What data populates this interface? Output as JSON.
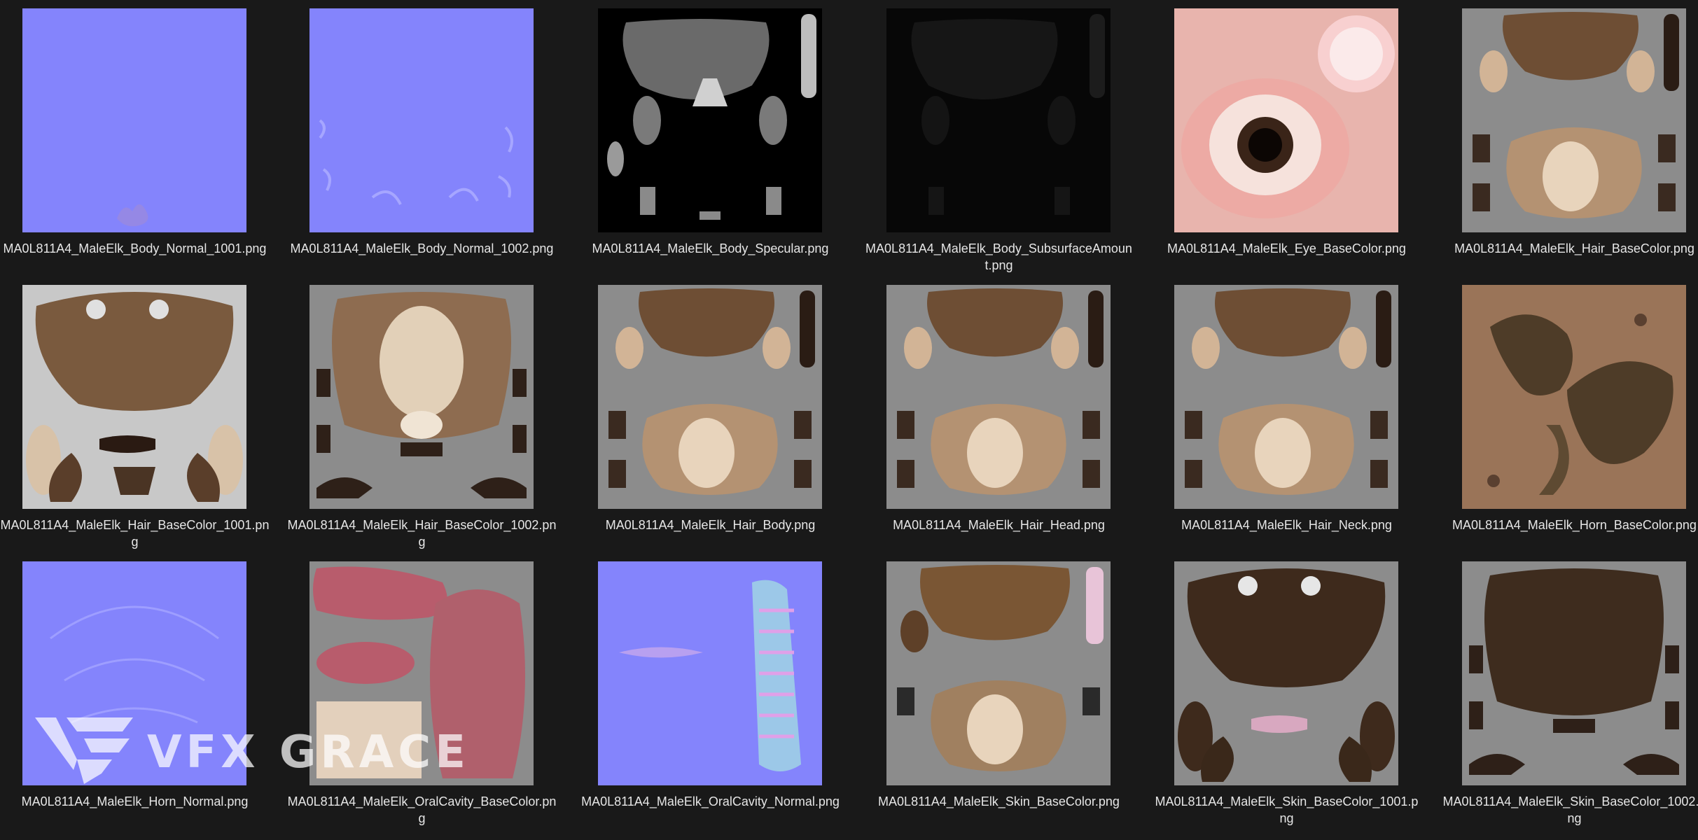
{
  "files": [
    {
      "name": "MA0L811A4_MaleElk_Body_Normal_1001.png",
      "thumb": "normal-icon"
    },
    {
      "name": "MA0L811A4_MaleElk_Body_Normal_1002.png",
      "thumb": "normal-icon"
    },
    {
      "name": "MA0L811A4_MaleElk_Body_Specular.png",
      "thumb": "specular-icon"
    },
    {
      "name": "MA0L811A4_MaleElk_Body_SubsurfaceAmount.png",
      "thumb": "subsurface-icon"
    },
    {
      "name": "MA0L811A4_MaleElk_Eye_BaseColor.png",
      "thumb": "eye-icon"
    },
    {
      "name": "MA0L811A4_MaleElk_Hair_BaseColor.png",
      "thumb": "hair-atlas-icon"
    },
    {
      "name": "MA0L811A4_MaleElk_Hair_BaseColor_1001.png",
      "thumb": "head-atlas-icon"
    },
    {
      "name": "MA0L811A4_MaleElk_Hair_BaseColor_1002.png",
      "thumb": "pelt-atlas-icon"
    },
    {
      "name": "MA0L811A4_MaleElk_Hair_Body.png",
      "thumb": "hair-atlas-icon"
    },
    {
      "name": "MA0L811A4_MaleElk_Hair_Head.png",
      "thumb": "hair-atlas-icon"
    },
    {
      "name": "MA0L811A4_MaleElk_Hair_Neck.png",
      "thumb": "hair-atlas-icon"
    },
    {
      "name": "MA0L811A4_MaleElk_Horn_BaseColor.png",
      "thumb": "horn-icon"
    },
    {
      "name": "MA0L811A4_MaleElk_Horn_Normal.png",
      "thumb": "normal-icon"
    },
    {
      "name": "MA0L811A4_MaleElk_OralCavity_BaseColor.png",
      "thumb": "oral-icon"
    },
    {
      "name": "MA0L811A4_MaleElk_OralCavity_Normal.png",
      "thumb": "oral-normal-icon"
    },
    {
      "name": "MA0L811A4_MaleElk_Skin_BaseColor.png",
      "thumb": "skin-atlas-icon"
    },
    {
      "name": "MA0L811A4_MaleElk_Skin_BaseColor_1001.png",
      "thumb": "dark-head-atlas-icon"
    },
    {
      "name": "MA0L811A4_MaleElk_Skin_BaseColor_1002.png",
      "thumb": "dark-pelt-atlas-icon"
    }
  ],
  "watermark": {
    "text": "VFX GRACE"
  },
  "colors": {
    "background": "#191919",
    "label": "#e6e6e6",
    "normal_map": "#8080ff",
    "gray_bg": "#8c8c8c",
    "fur_brown": "#7a5a3e",
    "fur_light": "#d8c2a8",
    "horn_bg": "#9a7458",
    "eye_pink": "#e8b0aa"
  }
}
